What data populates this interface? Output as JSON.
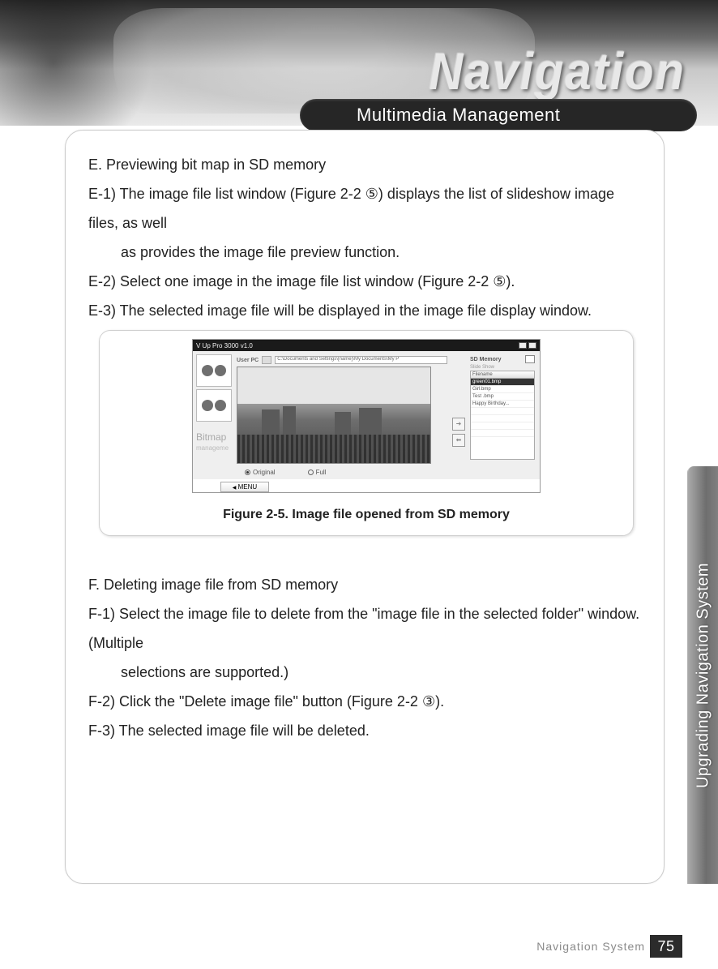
{
  "header": {
    "title": "Navigation",
    "section_pill": "Multimedia Management",
    "side_tab": "Upgrading Navigation System"
  },
  "footer": {
    "label": "Navigation System",
    "page": "75"
  },
  "section_e": {
    "heading": "E. Previewing bit map in SD memory",
    "e1_a": "E-1) The image file list window (Figure 2-2 ⑤) displays the list of slideshow image files, as well",
    "e1_b": "as provides the image file preview function.",
    "e2": "E-2) Select one image in the image file list window (Figure 2-2 ⑤).",
    "e3": "E-3) The selected image file will be displayed in the image file display window."
  },
  "figure": {
    "caption": "Figure 2-5. Image file opened from SD memory",
    "app": {
      "title_left": "V Up Pro 3000  v1.0",
      "user_pc_label": "User PC",
      "path": "C:\\Documents and Settings\\[name]\\My Documents\\My P",
      "sd_label": "SD Memory",
      "slide_label": "Slide Show",
      "file_header": "Filename",
      "files": {
        "r0": "green01.bmp",
        "r1": "Girl.bmp",
        "r2": "Test .bmp",
        "r3": "Happy Birthday..."
      },
      "radio_original": "Original",
      "radio_full": "Full",
      "menu": "MENU",
      "bitmap_label_top": "Bitmap",
      "bitmap_label_sub": "manageme"
    }
  },
  "section_f": {
    "heading": "F. Deleting image file from SD memory",
    "f1_a": "F-1) Select the image file to delete from the \"image file in the selected folder\" window. (Multiple",
    "f1_b": "selections are supported.)",
    "f2": "F-2) Click the \"Delete image file\" button (Figure 2-2 ③).",
    "f3": "F-3) The selected image file will be deleted."
  }
}
